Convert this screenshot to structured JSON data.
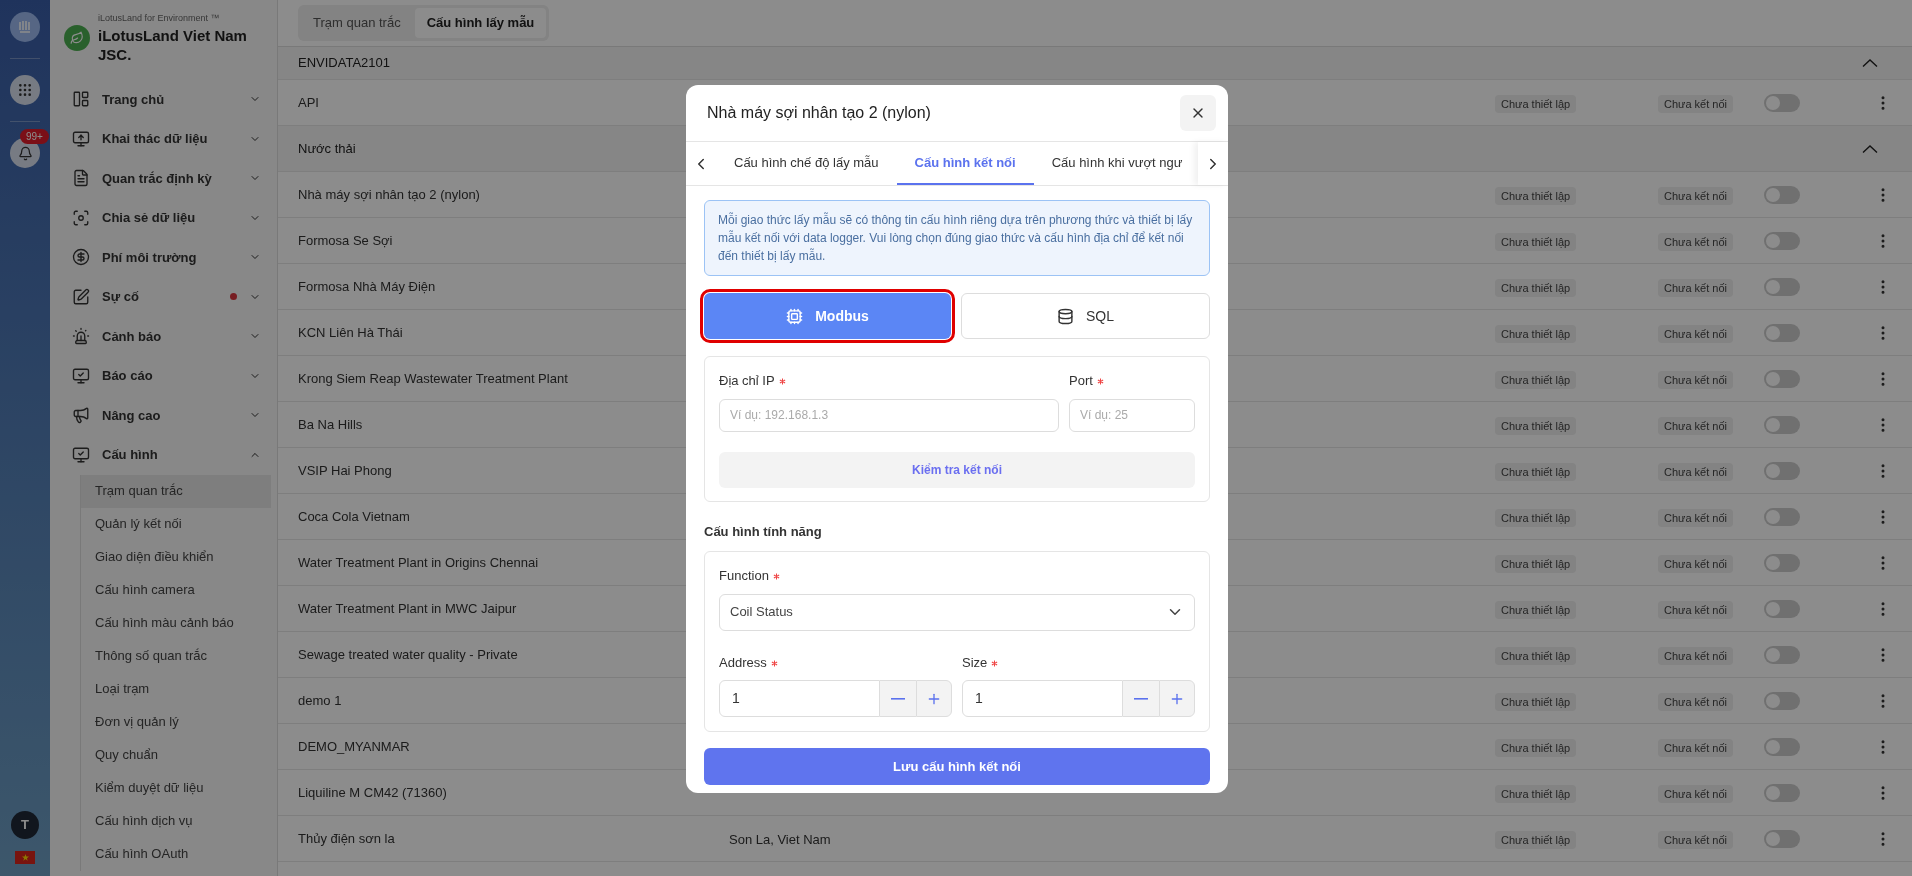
{
  "rail": {
    "notification_badge": "99+",
    "avatar_initial": "T"
  },
  "brand": {
    "tagline": "iLotusLand for Environment ™",
    "name": "iLotusLand Viet Nam JSC."
  },
  "menu": [
    {
      "label": "Trang chủ",
      "expanded": false,
      "alert": false
    },
    {
      "label": "Khai thác dữ liệu",
      "expanded": false,
      "alert": false
    },
    {
      "label": "Quan trắc định kỳ",
      "expanded": false,
      "alert": false
    },
    {
      "label": "Chia sẻ dữ liệu",
      "expanded": false,
      "alert": false
    },
    {
      "label": "Phí môi trường",
      "expanded": false,
      "alert": false
    },
    {
      "label": "Sự cố",
      "expanded": false,
      "alert": true
    },
    {
      "label": "Cảnh báo",
      "expanded": false,
      "alert": false
    },
    {
      "label": "Báo cáo",
      "expanded": false,
      "alert": false
    },
    {
      "label": "Nâng cao",
      "expanded": false,
      "alert": false
    },
    {
      "label": "Cấu hình",
      "expanded": true,
      "alert": false,
      "children": [
        {
          "label": "Trạm quan trắc",
          "selected": true
        },
        {
          "label": "Quản lý kết nối",
          "selected": false
        },
        {
          "label": "Giao diện điều khiển",
          "selected": false
        },
        {
          "label": "Cấu hình camera",
          "selected": false
        },
        {
          "label": "Cấu hình màu cảnh báo",
          "selected": false
        },
        {
          "label": "Thông số quan trắc",
          "selected": false
        },
        {
          "label": "Loại trạm",
          "selected": false
        },
        {
          "label": "Đơn vị quản lý",
          "selected": false
        },
        {
          "label": "Quy chuẩn",
          "selected": false
        },
        {
          "label": "Kiểm duyệt dữ liệu",
          "selected": false
        },
        {
          "label": "Cấu hình dịch vụ",
          "selected": false
        },
        {
          "label": "Cấu hình OAuth",
          "selected": false
        }
      ]
    }
  ],
  "view_tabs": [
    {
      "label": "Trạm quan trắc",
      "selected": false
    },
    {
      "label": "Cấu hình lấy mẫu",
      "selected": true
    }
  ],
  "groups": [
    {
      "name": "ENVIDATA2101",
      "expanded": true,
      "stations": [
        {
          "name": "API",
          "setup": "Chưa thiết lập",
          "connection": "Chưa kết nối",
          "enabled": false
        }
      ]
    },
    {
      "name": "Nước thải",
      "expanded": true,
      "stations": [
        {
          "name": "Nhà máy sợi nhân tạo 2 (nylon)",
          "setup": "Chưa thiết lập",
          "connection": "Chưa kết nối",
          "enabled": false
        },
        {
          "name": "Formosa Se Sợi",
          "setup": "Chưa thiết lập",
          "connection": "Chưa kết nối",
          "enabled": false
        },
        {
          "name": "Formosa Nhà Máy Điện",
          "setup": "Chưa thiết lập",
          "connection": "Chưa kết nối",
          "enabled": false
        },
        {
          "name": "KCN Liên Hà Thái",
          "setup": "Chưa thiết lập",
          "connection": "Chưa kết nối",
          "enabled": false
        },
        {
          "name": "Krong Siem Reap Wastewater Treatment Plant",
          "setup": "Chưa thiết lập",
          "connection": "Chưa kết nối",
          "enabled": false
        },
        {
          "name": "Ba Na Hills",
          "setup": "Chưa thiết lập",
          "connection": "Chưa kết nối",
          "enabled": false
        },
        {
          "name": "VSIP Hai Phong",
          "setup": "Chưa thiết lập",
          "connection": "Chưa kết nối",
          "enabled": false
        },
        {
          "name": "Coca Cola Vietnam",
          "setup": "Chưa thiết lập",
          "connection": "Chưa kết nối",
          "enabled": false
        },
        {
          "name": "Water Treatment Plant in Origins Chennai",
          "setup": "Chưa thiết lập",
          "connection": "Chưa kết nối",
          "enabled": false
        },
        {
          "name": "Water Treatment Plant in MWC Jaipur",
          "setup": "Chưa thiết lập",
          "connection": "Chưa kết nối",
          "enabled": false
        },
        {
          "name": "Sewage treated water quality - Private",
          "setup": "Chưa thiết lập",
          "connection": "Chưa kết nối",
          "enabled": false
        },
        {
          "name": "demo 1",
          "setup": "Chưa thiết lập",
          "connection": "Chưa kết nối",
          "enabled": false
        },
        {
          "name": "DEMO_MYANMAR",
          "setup": "Chưa thiết lập",
          "connection": "Chưa kết nối",
          "enabled": false
        },
        {
          "name": "Liquiline M CM42 (71360)",
          "setup": "Chưa thiết lập",
          "connection": "Chưa kết nối",
          "enabled": false
        },
        {
          "name": "Thủy điện sơn la",
          "location": "Son La, Viet Nam",
          "setup": "Chưa thiết lập",
          "connection": "Chưa kết nối",
          "enabled": false
        }
      ]
    }
  ],
  "dialog": {
    "title": "Nhà máy sợi nhân tạo 2 (nylon)",
    "tabs": [
      {
        "label": "Cấu hình chế độ lấy mẫu",
        "selected": false
      },
      {
        "label": "Cấu hình kết nối",
        "selected": true
      },
      {
        "label": "Cấu hình khi vượt ngư",
        "selected": false
      }
    ],
    "info": "Mỗi giao thức lấy mẫu sẽ có thông tin cấu hình riêng dựa trên phương thức và thiết bị lấy mẫu kết nối với data logger. Vui lòng chọn đúng giao thức và cấu hình địa chỉ để kết nối đến thiết bị lấy mẫu.",
    "protocols": [
      {
        "kind": "chip",
        "label": "Modbus",
        "selected": true,
        "highlighted": true
      },
      {
        "kind": "database",
        "label": "SQL",
        "selected": false,
        "highlighted": false
      }
    ],
    "ip": {
      "label": "Địa chỉ IP",
      "required": true,
      "placeholder": "Ví dụ: 192.168.1.3"
    },
    "port": {
      "label": "Port",
      "required": true,
      "placeholder": "Ví dụ: 25"
    },
    "test_button": "Kiểm tra kết nối",
    "feature_title": "Cấu hình tính năng",
    "function": {
      "label": "Function",
      "required": true,
      "value": "Coil Status"
    },
    "address": {
      "label": "Address",
      "required": true,
      "value": "1"
    },
    "size": {
      "label": "Size",
      "required": true,
      "value": "1"
    },
    "save_button": "Lưu cấu hình kết nối"
  }
}
